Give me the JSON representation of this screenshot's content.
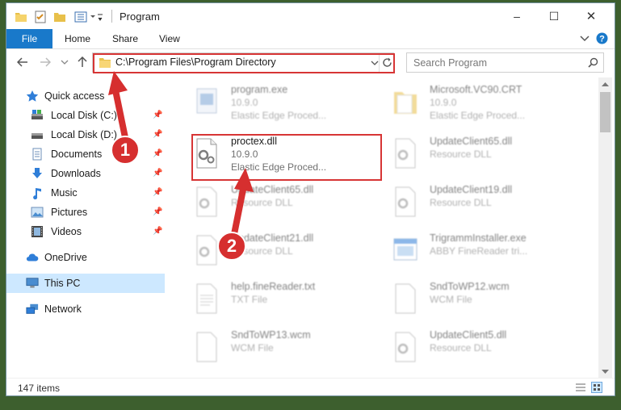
{
  "window": {
    "title": "Program",
    "caption_buttons": {
      "minimize": "–",
      "maximize": "☐",
      "close": "✕"
    }
  },
  "ribbon": {
    "file": "File",
    "tabs": [
      "Home",
      "Share",
      "View"
    ]
  },
  "address": {
    "path": "C:\\Program Files\\Program Directory"
  },
  "search": {
    "placeholder": "Search Program"
  },
  "nav": {
    "quick_access": "Quick access",
    "items": [
      {
        "label": "Local Disk (C:)",
        "icon": "drive-icon",
        "pinned": true
      },
      {
        "label": "Local Disk (D:)",
        "icon": "drive-icon",
        "pinned": true
      },
      {
        "label": "Documents",
        "icon": "documents-icon",
        "pinned": true
      },
      {
        "label": "Downloads",
        "icon": "downloads-icon",
        "pinned": true
      },
      {
        "label": "Music",
        "icon": "music-icon",
        "pinned": true
      },
      {
        "label": "Pictures",
        "icon": "pictures-icon",
        "pinned": true
      },
      {
        "label": "Videos",
        "icon": "videos-icon",
        "pinned": true
      }
    ],
    "onedrive": "OneDrive",
    "this_pc": "This PC",
    "network": "Network"
  },
  "files": [
    {
      "name": "program.exe",
      "version": "10.9.0",
      "type": "Elastic Edge Proced...",
      "icon": "exe-icon"
    },
    {
      "name": "Microsoft.VC90.CRT",
      "version": "10.9.0",
      "type": "Elastic Edge Proced...",
      "icon": "folder-icon"
    },
    {
      "name": "proctex.dll",
      "version": "10.9.0",
      "type": "Elastic Edge Proced...",
      "icon": "dll-icon"
    },
    {
      "name": "UpdateClient65.dll",
      "version": "",
      "type": "Resource DLL",
      "icon": "dll-icon"
    },
    {
      "name": "UpdateClient65.dll",
      "version": "",
      "type": "Resource DLL",
      "icon": "dll-icon"
    },
    {
      "name": "UpdateClient19.dll",
      "version": "",
      "type": "Resource DLL",
      "icon": "dll-icon"
    },
    {
      "name": "UpdateClient21.dll",
      "version": "",
      "type": "Resource DLL",
      "icon": "dll-icon"
    },
    {
      "name": "TrigrammInstaller.exe",
      "version": "",
      "type": "ABBY FineReader tri...",
      "icon": "exe-icon"
    },
    {
      "name": "help.fineReader.txt",
      "version": "",
      "type": "TXT File",
      "icon": "txt-icon"
    },
    {
      "name": "SndToWP12.wcm",
      "version": "",
      "type": "WCM File",
      "icon": "file-icon"
    },
    {
      "name": "SndToWP13.wcm",
      "version": "",
      "type": "WCM File",
      "icon": "file-icon"
    },
    {
      "name": "UpdateClient5.dll",
      "version": "",
      "type": "Resource DLL",
      "icon": "dll-icon"
    }
  ],
  "status": {
    "items_count": "147 items"
  },
  "callouts": {
    "step1": "1",
    "step2": "2"
  },
  "colors": {
    "accent": "#1979ca",
    "highlight": "#d73535",
    "selected": "#cde8ff"
  }
}
